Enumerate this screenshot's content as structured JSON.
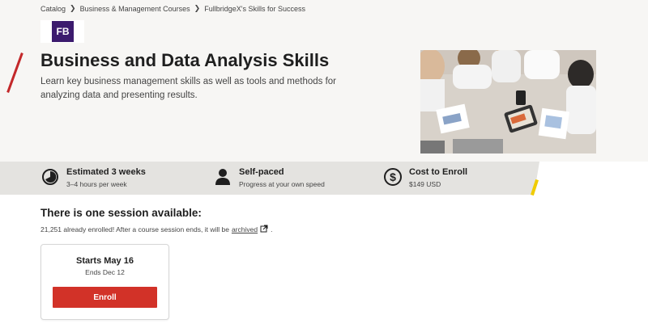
{
  "breadcrumb": [
    {
      "label": "Catalog"
    },
    {
      "label": "Business & Management Courses"
    },
    {
      "label": "FullbridgeX's Skills for Success"
    }
  ],
  "logo": {
    "text": "FB"
  },
  "course": {
    "title": "Business and Data Analysis Skills",
    "subtitle": "Learn key business management skills as well as tools and methods for analyzing data and presenting results."
  },
  "info": {
    "duration": {
      "main": "Estimated 3 weeks",
      "sub": "3–4 hours per week",
      "icon": "clock-icon"
    },
    "pace": {
      "main": "Self-paced",
      "sub": "Progress at your own speed",
      "icon": "person-icon"
    },
    "cost": {
      "main": "Cost to Enroll",
      "sub": "$149 USD",
      "icon": "dollar-icon"
    }
  },
  "sessions": {
    "heading": "There is one session available:",
    "note_prefix": "21,251 already enrolled! After a course session ends, it will be",
    "note_link": "archived",
    "note_suffix": "."
  },
  "session_card": {
    "starts": "Starts May 16",
    "ends": "Ends Dec 12",
    "button": "Enroll"
  },
  "colors": {
    "accent_red": "#d23228",
    "accent_yellow": "#f0cc00",
    "logo_purple": "#3c1b6e"
  }
}
